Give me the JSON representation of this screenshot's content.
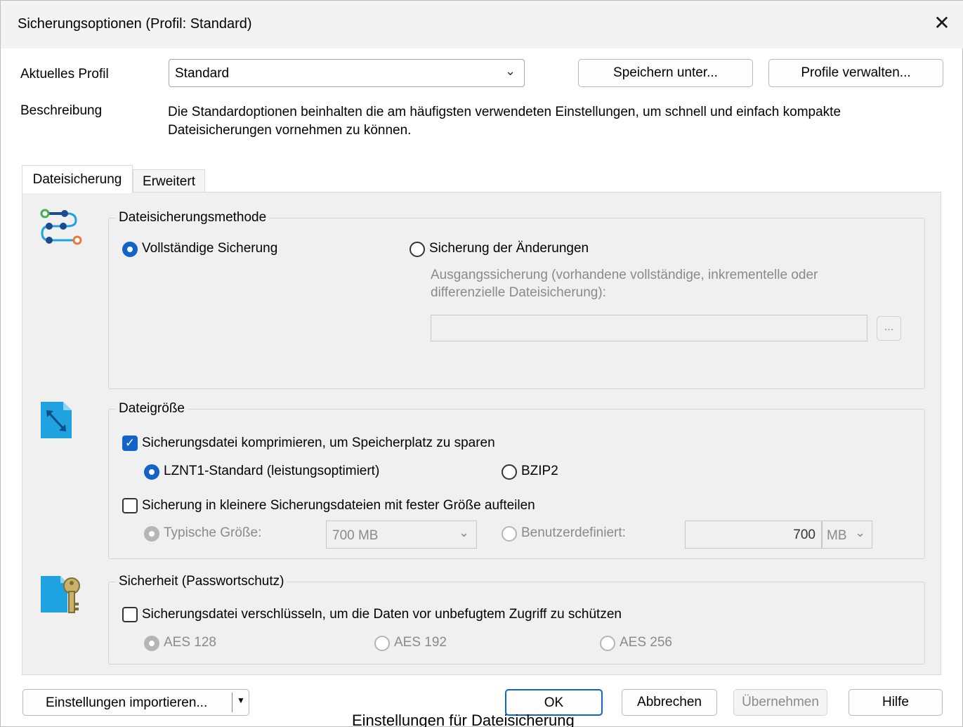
{
  "window": {
    "title": "Sicherungsoptionen (Profil: Standard)",
    "close": "✕"
  },
  "profile": {
    "label": "Aktuelles Profil",
    "selected": "Standard",
    "save_as": "Speichern unter...",
    "manage": "Profile verwalten..."
  },
  "description": {
    "label": "Beschreibung",
    "line1": "Die Standardoptionen beinhalten die am häufigsten verwendeten Einstellungen, um schnell und einfach kompakte",
    "line2": "Dateisicherungen vornehmen zu können."
  },
  "tabs": [
    {
      "label": "Dateisicherung",
      "active": true
    },
    {
      "label": "Erweitert",
      "active": false
    }
  ],
  "method": {
    "title": "Dateisicherungsmethode",
    "full": "Vollständige Sicherung",
    "changes": "Sicherung der Änderungen",
    "base_line1": "Ausgangssicherung (vorhandene vollständige, inkrementelle oder",
    "base_line2": "differenzielle Dateisicherung):",
    "base_path": "",
    "browse": "..."
  },
  "filesize": {
    "title": "Dateigröße",
    "compress": "Sicherungsdatei komprimieren, um Speicherplatz zu sparen",
    "lznt1": "LZNT1-Standard (leistungsoptimiert)",
    "bzip2": "BZIP2",
    "split": "Sicherung in kleinere Sicherungsdateien mit fester Größe aufteilen",
    "typical": "Typische Größe:",
    "typical_value": "700 MB",
    "custom": "Benutzerdefiniert:",
    "custom_value": "700",
    "custom_unit": "MB"
  },
  "security": {
    "title": "Sicherheit (Passwortschutz)",
    "encrypt": "Sicherungsdatei verschlüsseln, um die Daten vor unbefugtem Zugriff zu schützen",
    "aes128": "AES 128",
    "aes192": "AES 192",
    "aes256": "AES 256"
  },
  "footer": {
    "import": "Einstellungen importieren...",
    "ok": "OK",
    "cancel": "Abbrechen",
    "apply": "Übernehmen",
    "help": "Hilfe"
  },
  "caption": "Einstellungen für Dateisicherung",
  "colors": {
    "accent": "#1264c7",
    "icon_blue": "#1fa3e0"
  }
}
